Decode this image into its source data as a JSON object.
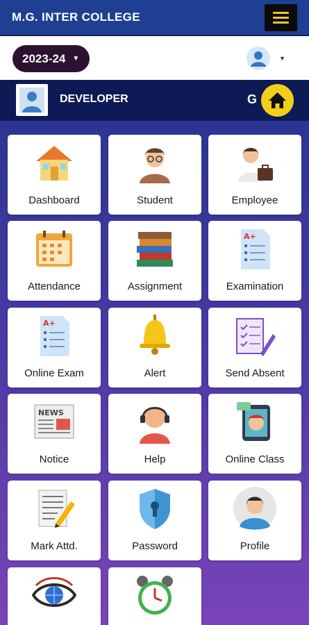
{
  "header": {
    "title": "M.G. INTER COLLEGE",
    "menu_icon": "hamburger-icon"
  },
  "toolbar": {
    "session_year": "2023-24"
  },
  "user": {
    "name": "DEVELOPER",
    "initial": "G"
  },
  "tiles": [
    {
      "label": "Dashboard",
      "icon": "house-icon"
    },
    {
      "label": "Student",
      "icon": "student-icon"
    },
    {
      "label": "Employee",
      "icon": "employee-icon"
    },
    {
      "label": "Attendance",
      "icon": "calendar-icon"
    },
    {
      "label": "Assignment",
      "icon": "books-icon"
    },
    {
      "label": "Examination",
      "icon": "exam-sheet-icon"
    },
    {
      "label": "Online Exam",
      "icon": "online-exam-icon"
    },
    {
      "label": "Alert",
      "icon": "bell-icon"
    },
    {
      "label": "Send Absent",
      "icon": "checklist-icon"
    },
    {
      "label": "Notice",
      "icon": "newspaper-icon"
    },
    {
      "label": "Help",
      "icon": "support-agent-icon"
    },
    {
      "label": "Online Class",
      "icon": "video-class-icon"
    },
    {
      "label": "Mark Attd.",
      "icon": "notepad-pencil-icon"
    },
    {
      "label": "Password",
      "icon": "shield-lock-icon"
    },
    {
      "label": "Profile",
      "icon": "profile-avatar-icon"
    },
    {
      "label": "",
      "icon": "eye-globe-icon"
    },
    {
      "label": "",
      "icon": "alarm-clock-icon"
    }
  ]
}
